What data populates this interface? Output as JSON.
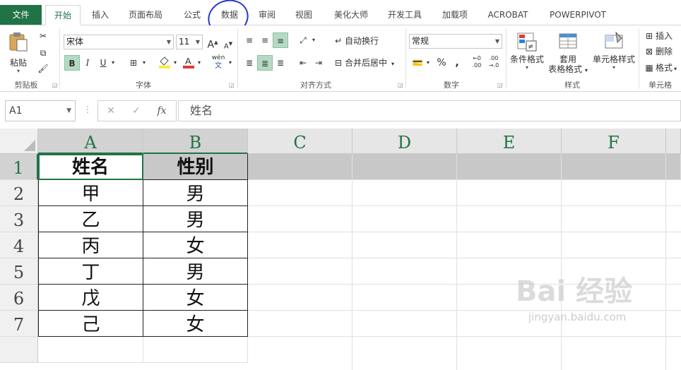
{
  "tabs": {
    "file": "文件",
    "home": "开始",
    "insert": "插入",
    "page_layout": "页面布局",
    "formulas": "公式",
    "data": "数据",
    "review": "审阅",
    "view": "视图",
    "beautify": "美化大师",
    "developer": "开发工具",
    "addins": "加载项",
    "acrobat": "ACROBAT",
    "powerpivot": "POWERPIVOT"
  },
  "ribbon": {
    "clipboard": {
      "paste": "粘贴",
      "label": "剪贴板"
    },
    "font": {
      "name": "宋体",
      "size": "11",
      "label": "字体",
      "bold": "B",
      "italic": "I",
      "underline": "U",
      "wen": "wén"
    },
    "alignment": {
      "wrap": "自动换行",
      "merge": "合并后居中",
      "label": "对齐方式"
    },
    "number": {
      "format": "常规",
      "percent": "%",
      "comma": ",",
      "label": "数字"
    },
    "styles": {
      "conditional": "条件格式",
      "table_line1": "套用",
      "table_line2": "表格格式",
      "cell_styles": "单元格样式",
      "label": "样式"
    },
    "cells": {
      "insert": "插入",
      "delete": "删除",
      "format": "格式",
      "label": "单元格"
    }
  },
  "formula_bar": {
    "name_box": "A1",
    "fx": "fx",
    "content": "姓名"
  },
  "columns": [
    "A",
    "B",
    "C",
    "D",
    "E",
    "F"
  ],
  "rows": [
    "1",
    "2",
    "3",
    "4",
    "5",
    "6",
    "7"
  ],
  "cells": {
    "a1": "姓名",
    "b1": "性别",
    "a2": "甲",
    "b2": "男",
    "a3": "乙",
    "b3": "男",
    "a4": "丙",
    "b4": "女",
    "a5": "丁",
    "b5": "男",
    "a6": "戊",
    "b6": "女",
    "a7": "己",
    "b7": "女"
  },
  "watermark": {
    "text": "Bai 经验",
    "sub": "jingyan.baidu.com"
  },
  "colors": {
    "excel_green": "#217346",
    "circle": "#2636d6"
  }
}
